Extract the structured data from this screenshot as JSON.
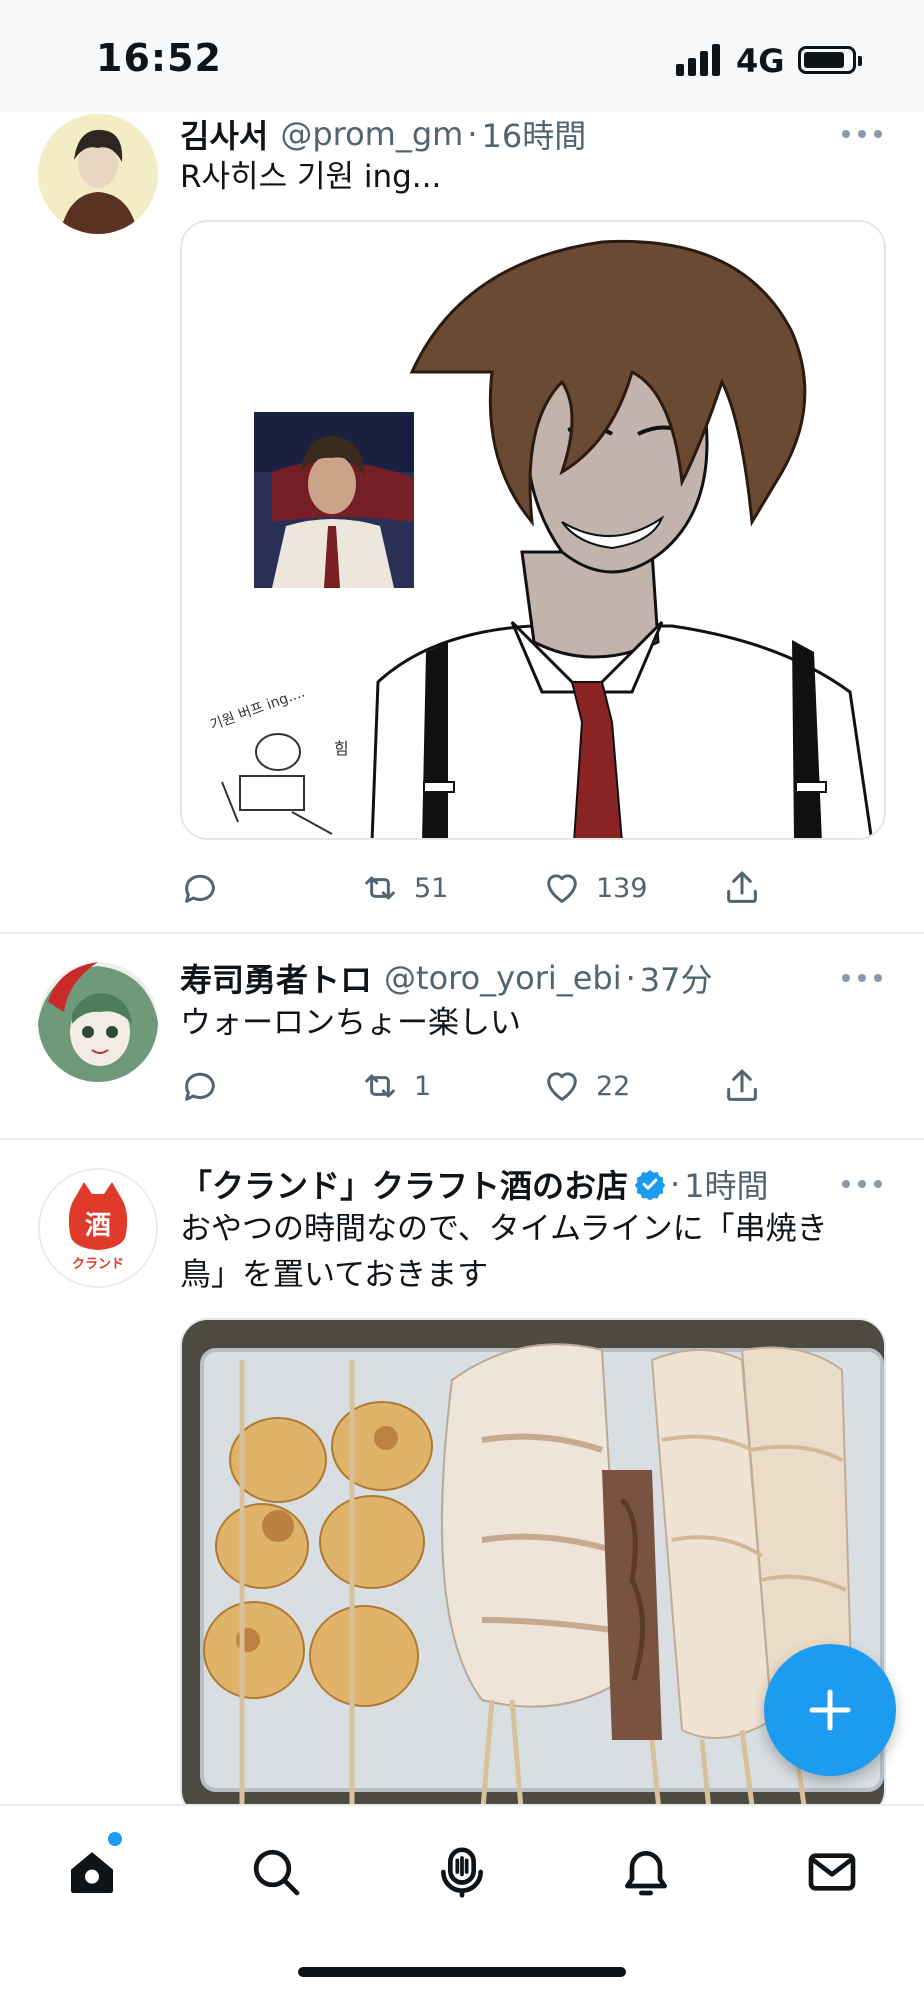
{
  "status_bar": {
    "time": "16:52",
    "network": "4G"
  },
  "tweets": [
    {
      "name": "김사서",
      "handle": "@prom_gm",
      "separator": "·",
      "time": "16時間",
      "text": "R사히스 기원 ing...",
      "retweets": "51",
      "likes": "139",
      "media_caption": "기원 버프 ing....",
      "media_sticker_text": "힘"
    },
    {
      "name": "寿司勇者トロ",
      "handle": "@toro_yori_ebi",
      "separator": "·",
      "time": "37分",
      "text": "ウォーロンちょー楽しい",
      "retweets": "1",
      "likes": "22"
    },
    {
      "name": "「クランド」クラフト酒のお店",
      "separator": "·",
      "time": "1時間",
      "verified": true,
      "text_line1": "おやつの時間なので、タイムラインに「串焼き",
      "text_line2": "鳥」を置いておきます",
      "avatar_kanji": "酒",
      "avatar_label": "クランド"
    }
  ],
  "colors": {
    "accent": "#1d9bf0",
    "text": "#0f1419",
    "muted": "#536471"
  },
  "icons": {
    "reply": "reply-icon",
    "retweet": "retweet-icon",
    "like": "heart-icon",
    "share": "share-icon",
    "compose": "plus-icon",
    "nav": [
      "home-icon",
      "search-icon",
      "spaces-icon",
      "bell-icon",
      "mail-icon"
    ]
  }
}
